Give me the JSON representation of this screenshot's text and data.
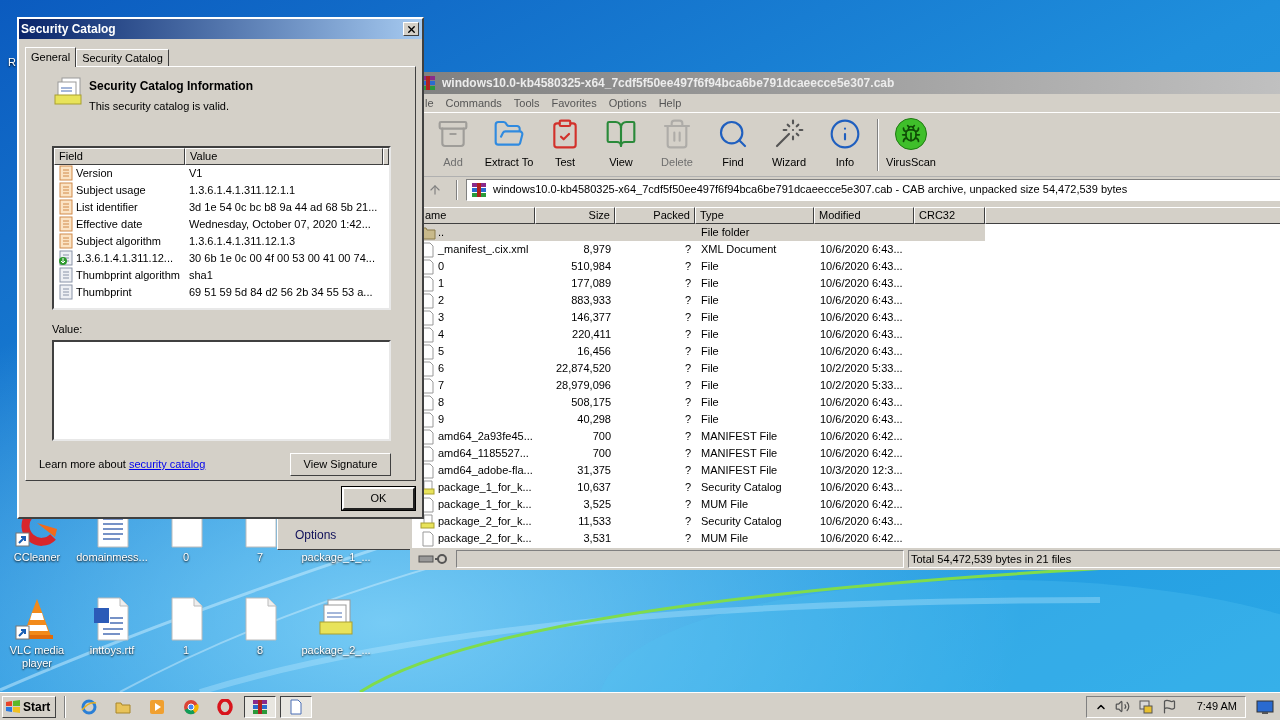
{
  "desktop_icons": [
    {
      "label": "R",
      "kind": "none"
    },
    {
      "label": "CCleaner",
      "kind": "ccleaner"
    },
    {
      "label": "domainmess...",
      "kind": "document"
    },
    {
      "label": "0",
      "kind": "blank"
    },
    {
      "label": "7",
      "kind": "blank"
    },
    {
      "label": "package_1_...",
      "kind": "none"
    },
    {
      "label": "VLC media player",
      "kind": "vlc"
    },
    {
      "label": "inttoys.rtf",
      "kind": "word"
    },
    {
      "label": "1",
      "kind": "blank"
    },
    {
      "label": "8",
      "kind": "blank"
    },
    {
      "label": "package_2_...",
      "kind": "catalog"
    }
  ],
  "context_menu": {
    "items": [
      "Options"
    ]
  },
  "archiver": {
    "title": "windows10.0-kb4580325-x64_7cdf5f50ee497f6f94bca6be791dcaeecce5e307.cab",
    "menu": [
      "le",
      "Commands",
      "Tools",
      "Favorites",
      "Options",
      "Help"
    ],
    "toolbar": [
      {
        "label": "Add",
        "kind": "add",
        "disabled": true
      },
      {
        "label": "Extract To",
        "kind": "extract",
        "disabled": false
      },
      {
        "label": "Test",
        "kind": "test",
        "disabled": false
      },
      {
        "label": "View",
        "kind": "view",
        "disabled": false
      },
      {
        "label": "Delete",
        "kind": "delete",
        "disabled": true
      },
      {
        "label": "Find",
        "kind": "find",
        "disabled": false
      },
      {
        "label": "Wizard",
        "kind": "wizard",
        "disabled": false
      },
      {
        "label": "Info",
        "kind": "info",
        "disabled": false
      },
      {
        "label": "VirusScan",
        "kind": "virusscan",
        "disabled": false
      }
    ],
    "path": "windows10.0-kb4580325-x64_7cdf5f50ee497f6f94bca6be791dcaeecce5e307.cab - CAB archive, unpacked size 54,472,539 bytes",
    "columns": [
      "ame",
      "Size",
      "Packed",
      "Type",
      "Modified",
      "CRC32"
    ],
    "rows": [
      {
        "kind": "folder",
        "name": "..",
        "type": "File folder",
        "selected": true
      },
      {
        "kind": "file",
        "name": "_manifest_.cix.xml",
        "size": "8,979",
        "packed": "?",
        "type": "XML Document",
        "modified": "10/6/2020 6:43...",
        "selected": false
      },
      {
        "kind": "file",
        "name": "0",
        "size": "510,984",
        "packed": "?",
        "type": "File",
        "modified": "10/6/2020 6:43...",
        "selected": false
      },
      {
        "kind": "file",
        "name": "1",
        "size": "177,089",
        "packed": "?",
        "type": "File",
        "modified": "10/6/2020 6:43...",
        "selected": false
      },
      {
        "kind": "file",
        "name": "2",
        "size": "883,933",
        "packed": "?",
        "type": "File",
        "modified": "10/6/2020 6:43...",
        "selected": false
      },
      {
        "kind": "file",
        "name": "3",
        "size": "146,377",
        "packed": "?",
        "type": "File",
        "modified": "10/6/2020 6:43...",
        "selected": false
      },
      {
        "kind": "file",
        "name": "4",
        "size": "220,411",
        "packed": "?",
        "type": "File",
        "modified": "10/6/2020 6:43...",
        "selected": false
      },
      {
        "kind": "file",
        "name": "5",
        "size": "16,456",
        "packed": "?",
        "type": "File",
        "modified": "10/6/2020 6:43...",
        "selected": false
      },
      {
        "kind": "file",
        "name": "6",
        "size": "22,874,520",
        "packed": "?",
        "type": "File",
        "modified": "10/2/2020 5:33...",
        "selected": false
      },
      {
        "kind": "file",
        "name": "7",
        "size": "28,979,096",
        "packed": "?",
        "type": "File",
        "modified": "10/2/2020 5:33...",
        "selected": false
      },
      {
        "kind": "file",
        "name": "8",
        "size": "508,175",
        "packed": "?",
        "type": "File",
        "modified": "10/6/2020 6:43...",
        "selected": false
      },
      {
        "kind": "file",
        "name": "9",
        "size": "40,298",
        "packed": "?",
        "type": "File",
        "modified": "10/6/2020 6:43...",
        "selected": false
      },
      {
        "kind": "file",
        "name": "amd64_2a93fe45...",
        "size": "700",
        "packed": "?",
        "type": "MANIFEST File",
        "modified": "10/6/2020 6:42...",
        "selected": false
      },
      {
        "kind": "file",
        "name": "amd64_1185527...",
        "size": "700",
        "packed": "?",
        "type": "MANIFEST File",
        "modified": "10/6/2020 6:42...",
        "selected": false
      },
      {
        "kind": "file",
        "name": "amd64_adobe-fla...",
        "size": "31,375",
        "packed": "?",
        "type": "MANIFEST File",
        "modified": "10/3/2020 12:3...",
        "selected": false
      },
      {
        "kind": "catalog",
        "name": "package_1_for_k...",
        "size": "10,637",
        "packed": "?",
        "type": "Security Catalog",
        "modified": "10/6/2020 6:43...",
        "selected": false
      },
      {
        "kind": "file",
        "name": "package_1_for_k...",
        "size": "3,525",
        "packed": "?",
        "type": "MUM File",
        "modified": "10/6/2020 6:42...",
        "selected": false
      },
      {
        "kind": "catalog",
        "name": "package_2_for_k...",
        "size": "11,533",
        "packed": "?",
        "type": "Security Catalog",
        "modified": "10/6/2020 6:43...",
        "selected": false
      },
      {
        "kind": "file",
        "name": "package_2_for_k...",
        "size": "3,531",
        "packed": "?",
        "type": "MUM File",
        "modified": "10/6/2020 6:42...",
        "selected": false
      }
    ],
    "status": "Total 54,472,539 bytes in 21 files"
  },
  "dialog": {
    "title": "Security Catalog",
    "tabs": [
      {
        "label": "General",
        "selected": true
      },
      {
        "label": "Security Catalog",
        "selected": false
      }
    ],
    "heading": "Security Catalog Information",
    "subheading": "This security catalog is valid.",
    "columns": [
      "Field",
      "Value"
    ],
    "fields": [
      {
        "kind": "property",
        "field": "Version",
        "value": "V1"
      },
      {
        "kind": "property",
        "field": "Subject usage",
        "value": "1.3.6.1.4.1.311.12.1.1"
      },
      {
        "kind": "property",
        "field": "List identifier",
        "value": "3d 1e 54 0c bc b8 9a 44 ad 68 5b 21..."
      },
      {
        "kind": "property",
        "field": "Effective date",
        "value": "Wednesday, October 07, 2020 1:42..."
      },
      {
        "kind": "property",
        "field": "Subject algorithm",
        "value": "1.3.6.1.4.1.311.12.1.3"
      },
      {
        "kind": "extension",
        "field": "1.3.6.1.4.1.311.12...",
        "value": "30 6b 1e 0c 00 4f 00 53 00 41 00 74..."
      },
      {
        "kind": "hash",
        "field": "Thumbprint algorithm",
        "value": "sha1"
      },
      {
        "kind": "hash",
        "field": "Thumbprint",
        "value": "69 51 59 5d 84 d2 56 2b 34 55 53 a..."
      }
    ],
    "value_label": "Value:",
    "learn_more": "Learn more about",
    "link": "security catalog",
    "view_button": "View Signature",
    "ok_button": "OK"
  },
  "taskbar": {
    "start": "Start",
    "items": [
      {
        "kind": "ie",
        "pressed": false
      },
      {
        "kind": "explorer",
        "pressed": false
      },
      {
        "kind": "media",
        "pressed": false
      },
      {
        "kind": "chrome",
        "pressed": false
      },
      {
        "kind": "opera",
        "pressed": false
      },
      {
        "kind": "winrar",
        "pressed": true
      },
      {
        "kind": "document",
        "pressed": true
      }
    ],
    "clock": "7:49 AM"
  }
}
